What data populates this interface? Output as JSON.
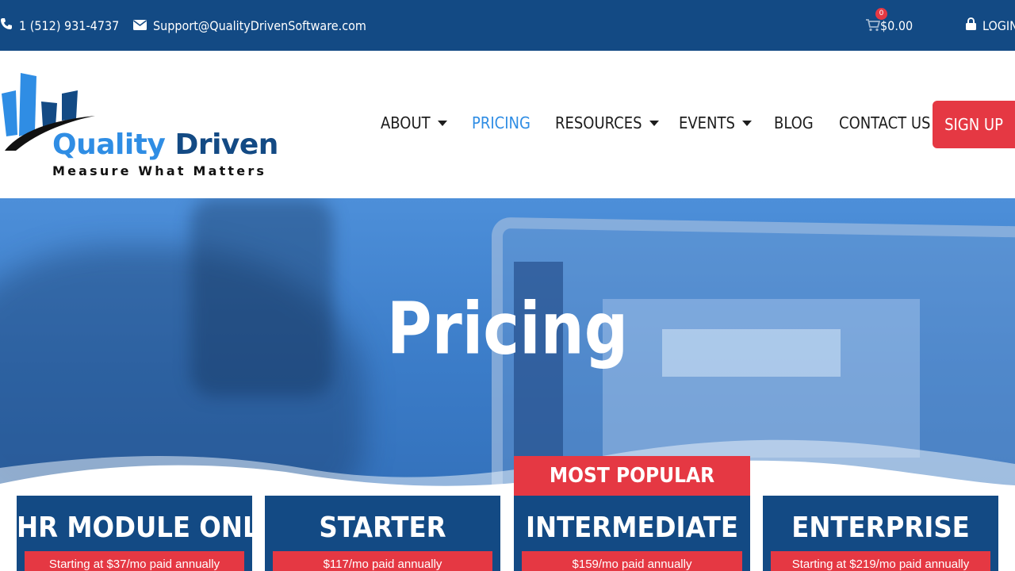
{
  "topbar": {
    "phone": "1 (512) 931-4737",
    "email": "Support@QualityDrivenSoftware.com",
    "cart_count": "0",
    "cart_total": "$0.00",
    "login": "LOGIN"
  },
  "header": {
    "logo_word1": "Quality",
    "logo_word2": "Driven",
    "logo_tagline": "Measure What Matters",
    "nav": {
      "about": "ABOUT",
      "pricing": "PRICING",
      "resources": "RESOURCES",
      "events": "EVENTS",
      "blog": "BLOG",
      "contact": "CONTACT US"
    },
    "signup": "SIGN UP"
  },
  "hero": {
    "title": "Pricing"
  },
  "pricing": {
    "badge": "MOST POPULAR",
    "plans": [
      {
        "name": "HR MODULE ONLY",
        "price": "Starting at $37/mo paid annually"
      },
      {
        "name": "STARTER",
        "price": "$117/mo paid annually"
      },
      {
        "name": "INTERMEDIATE",
        "price": "$159/mo paid annually"
      },
      {
        "name": "ENTERPRISE",
        "price": "Starting at $219/mo paid annually"
      }
    ]
  },
  "colors": {
    "brand_navy": "#134a84",
    "brand_blue": "#2f8de4",
    "accent_red": "#e53843"
  },
  "icons": [
    "phone-icon",
    "envelope-icon",
    "cart-icon",
    "lock-icon",
    "caret-down-icon"
  ]
}
